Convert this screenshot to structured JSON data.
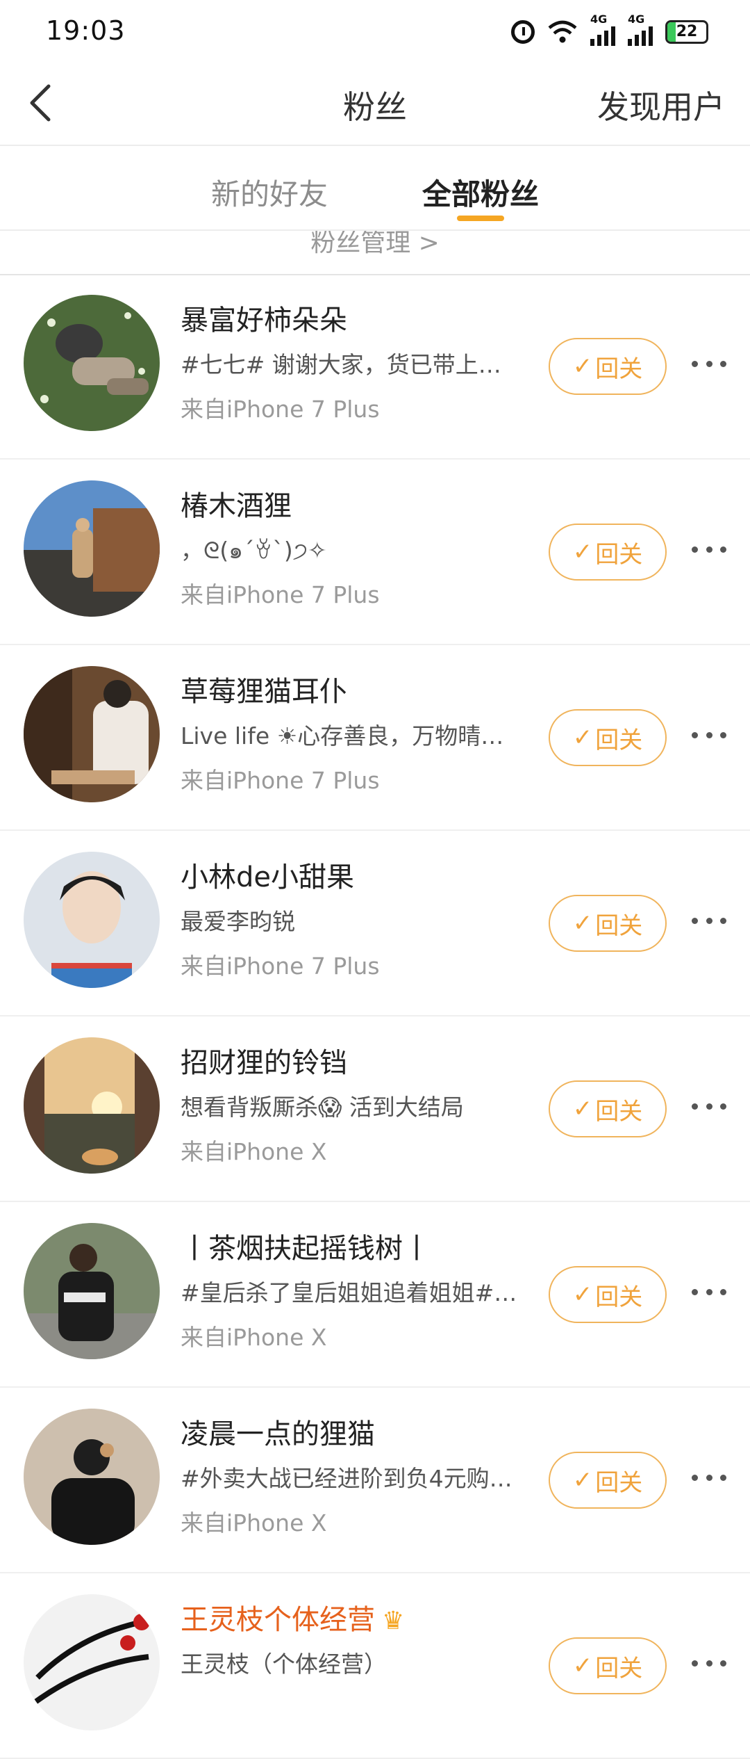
{
  "status_bar": {
    "time": "19:03",
    "net1": "4G",
    "net2": "4G",
    "battery": "22",
    "battery_level": 0.22
  },
  "header": {
    "title": "粉丝",
    "action": "发现用户"
  },
  "tabs": [
    {
      "label": "新的好友",
      "active": false
    },
    {
      "label": "全部粉丝",
      "active": true
    }
  ],
  "manage": {
    "label": "粉丝管理 >"
  },
  "fans": [
    {
      "name": "暴富好柿朵朵",
      "bio": "#七七# 谢谢大家，货已带上…",
      "source": "来自iPhone 7 Plus",
      "button": "回关"
    },
    {
      "name": "椿木酒狸",
      "bio": "，ᘓ(๑´ꈊ`)੭✧",
      "source": "来自iPhone 7 Plus",
      "button": "回关"
    },
    {
      "name": "草莓狸猫耳仆",
      "bio": "Live life ☀心存善良，万物晴…",
      "source": "来自iPhone 7 Plus",
      "button": "回关"
    },
    {
      "name": "小林de小甜果",
      "bio": "最爱李昀锐",
      "source": "来自iPhone 7 Plus",
      "button": "回关"
    },
    {
      "name": "招财狸的铃铛",
      "bio": "想看背叛厮杀😱 活到大结局",
      "source": "来自iPhone X",
      "button": "回关"
    },
    {
      "name": "丨茶烟扶起摇钱树丨",
      "bio": "#皇后杀了皇后姐姐追着姐姐#…",
      "source": "来自iPhone X",
      "button": "回关"
    },
    {
      "name": "凌晨一点的狸猫",
      "bio": "#外卖大战已经进阶到负4元购…",
      "source": "来自iPhone X",
      "button": "回关"
    },
    {
      "name": "王灵枝个体经营",
      "bio": "王灵枝（个体经营）",
      "source": "",
      "button": "回关"
    }
  ],
  "colors": {
    "accent": "#f0a33c",
    "vip_name": "#e6611c",
    "tab_underline": "#f5a623"
  }
}
